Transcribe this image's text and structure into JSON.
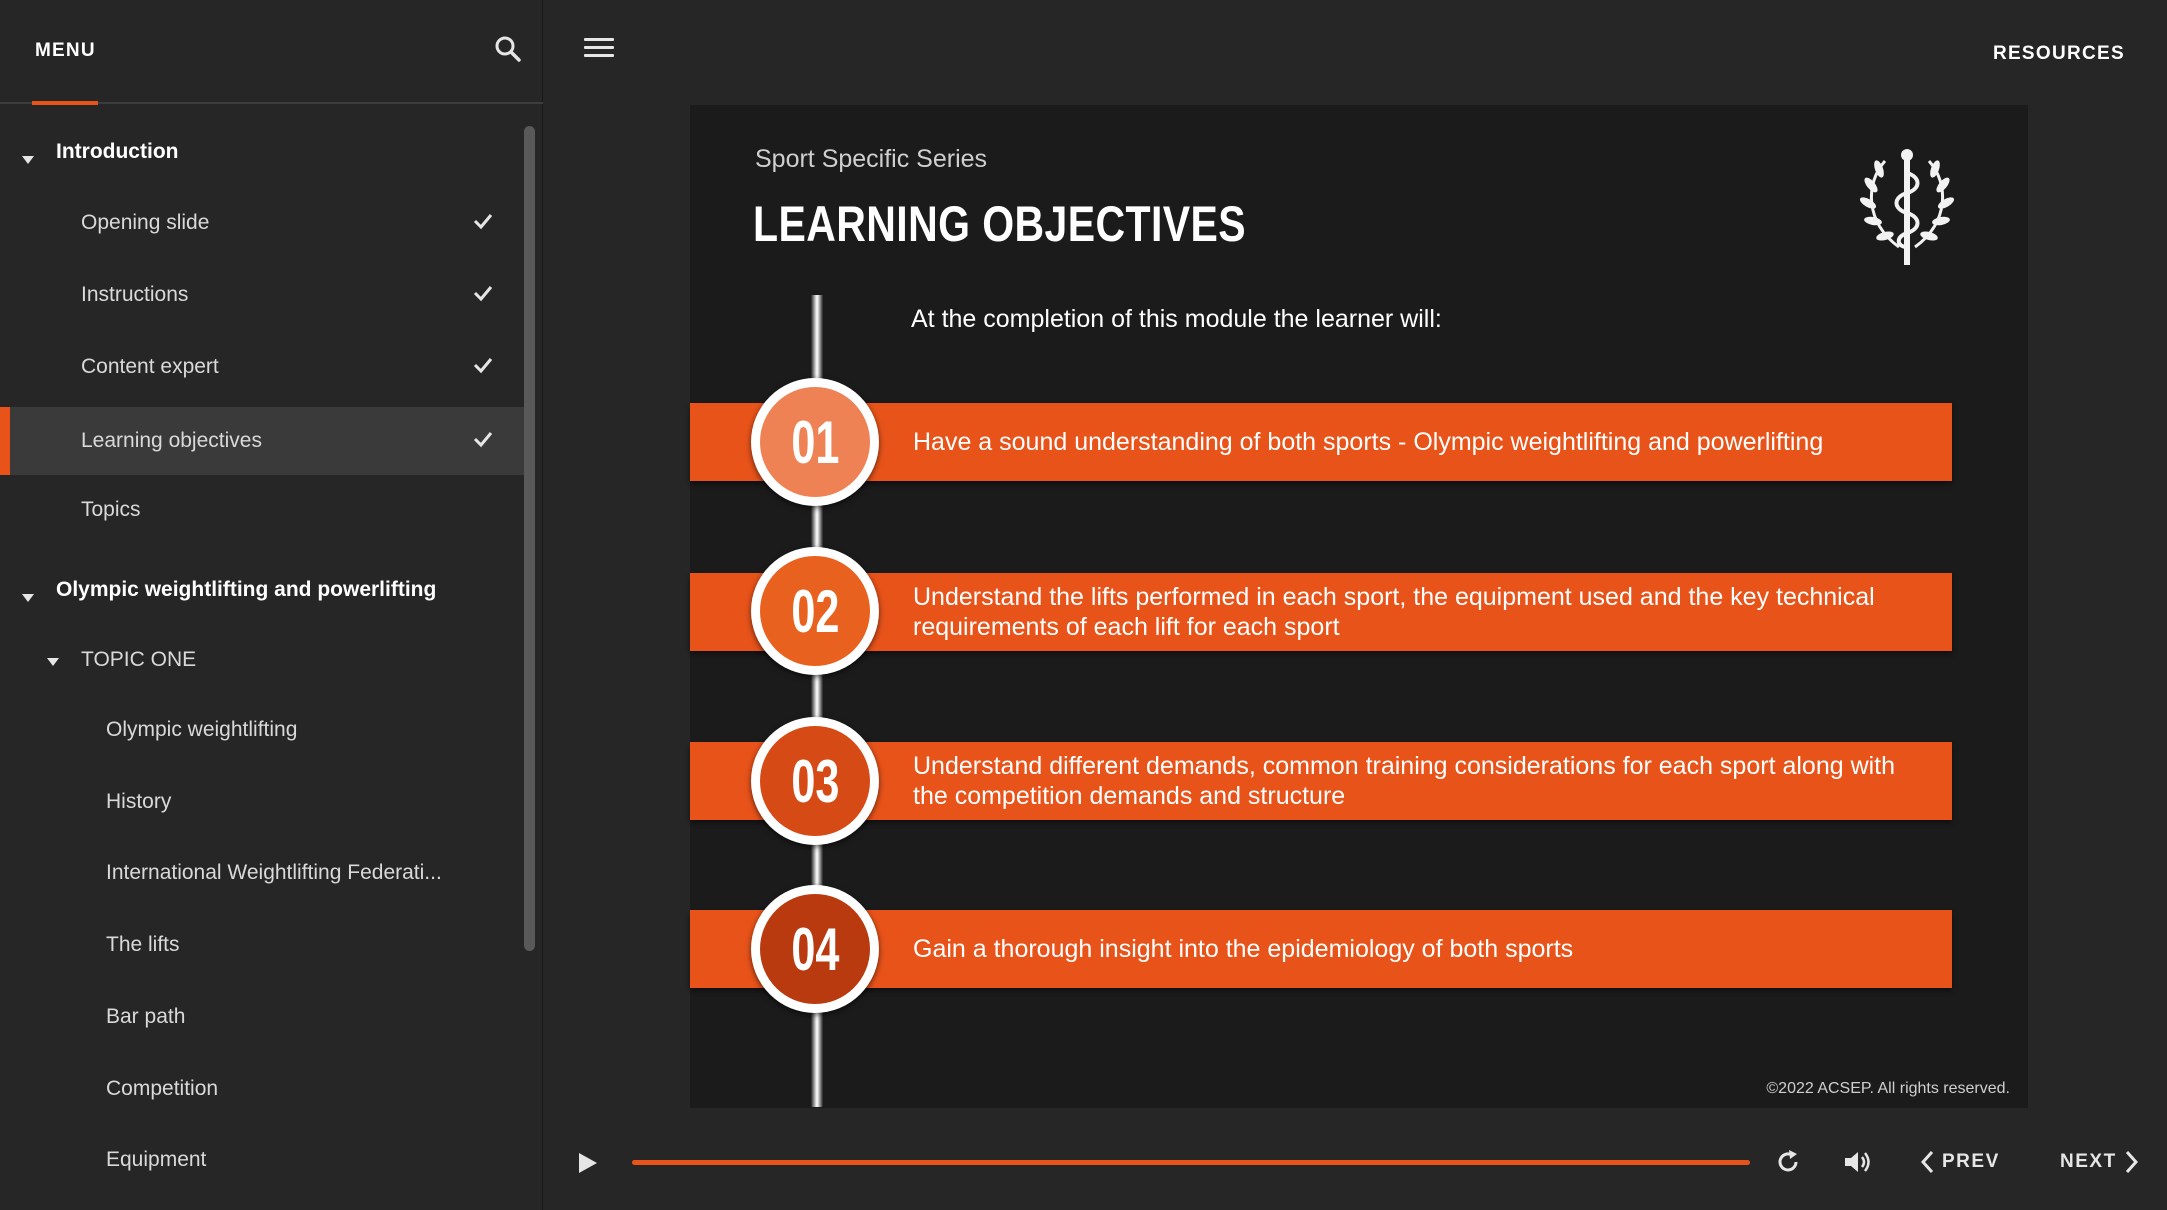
{
  "sidebar": {
    "menu_label": "MENU",
    "items": [
      {
        "label": "Introduction",
        "kind": "section",
        "expanded": true
      },
      {
        "label": "Opening slide",
        "kind": "item",
        "completed": true
      },
      {
        "label": "Instructions",
        "kind": "item",
        "completed": true
      },
      {
        "label": "Content expert",
        "kind": "item",
        "completed": true
      },
      {
        "label": "Learning objectives",
        "kind": "item",
        "completed": true,
        "active": true
      },
      {
        "label": "Topics",
        "kind": "item",
        "completed": false
      },
      {
        "label": "Olympic weightlifting and powerlifting",
        "kind": "section",
        "expanded": true
      },
      {
        "label": "TOPIC ONE",
        "kind": "subsection",
        "expanded": true
      },
      {
        "label": "Olympic weightlifting",
        "kind": "subitem"
      },
      {
        "label": "History",
        "kind": "subitem"
      },
      {
        "label": "International Weightlifting Federati...",
        "kind": "subitem"
      },
      {
        "label": "The lifts",
        "kind": "subitem"
      },
      {
        "label": "Bar path",
        "kind": "subitem"
      },
      {
        "label": "Competition",
        "kind": "subitem"
      },
      {
        "label": "Equipment",
        "kind": "subitem"
      }
    ]
  },
  "topbar": {
    "resources_label": "RESOURCES"
  },
  "slide": {
    "series": "Sport Specific Series",
    "title": "LEARNING OBJECTIVES",
    "intro": "At the completion of this module the learner will:",
    "objectives": [
      {
        "number": "01",
        "text": "Have a sound understanding of both sports - Olympic weightlifting and powerlifting",
        "circle_color": "#ef8254"
      },
      {
        "number": "02",
        "text": "Understand the lifts performed in each sport, the equipment used and the key technical requirements of each lift for each sport",
        "circle_color": "#e8611f"
      },
      {
        "number": "03",
        "text": "Understand different demands, common training considerations for each sport along with the competition demands and structure",
        "circle_color": "#d64a15"
      },
      {
        "number": "04",
        "text": "Gain a thorough insight into the epidemiology of both sports",
        "circle_color": "#b83a0e"
      }
    ],
    "copyright": "©2022 ACSEP. All rights reserved."
  },
  "player": {
    "progress": 1.0,
    "prev_label": "PREV",
    "next_label": "NEXT"
  },
  "colors": {
    "accent": "#e8531a",
    "background": "#262626",
    "slide_background": "#1b1b1b"
  }
}
